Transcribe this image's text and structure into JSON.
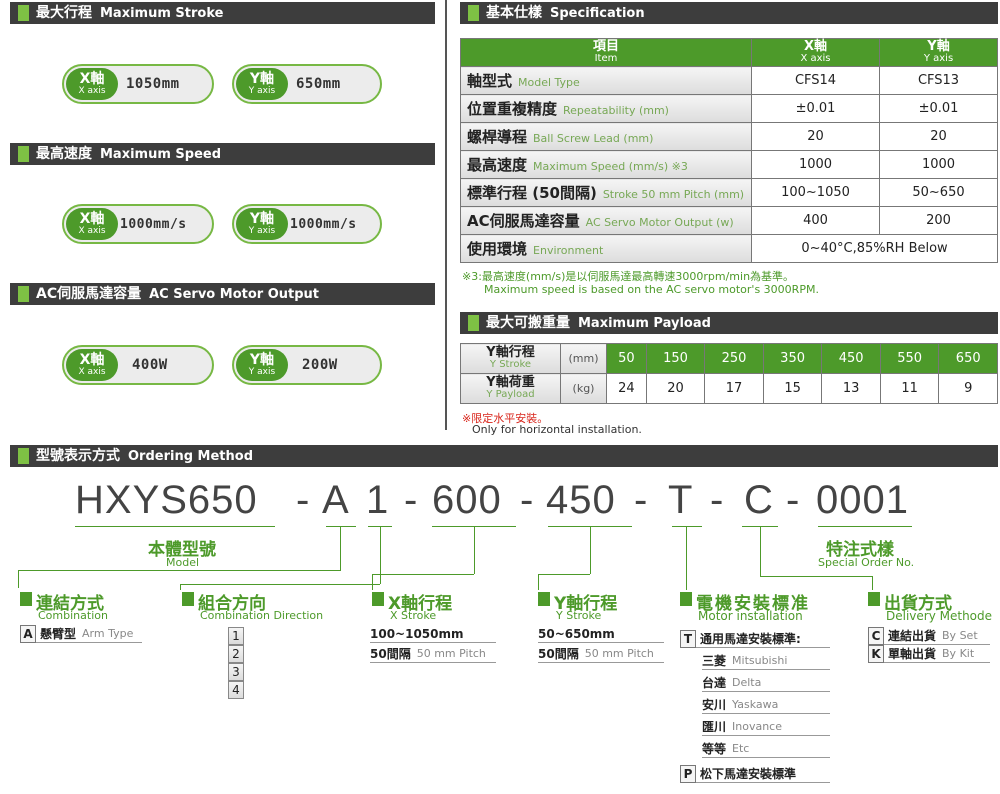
{
  "max_stroke": {
    "title": "最大行程",
    "title_en": "Maximum Stroke",
    "x_label": "X軸",
    "x_en": "X axis",
    "x_value": "1050mm",
    "y_label": "Y軸",
    "y_en": "Y axis",
    "y_value": "650mm"
  },
  "max_speed": {
    "title": "最高速度",
    "title_en": "Maximum Speed",
    "x_label": "X軸",
    "x_en": "X axis",
    "x_value": "1000mm/s",
    "y_label": "Y軸",
    "y_en": "Y axis",
    "y_value": "1000mm/s"
  },
  "servo": {
    "title": "AC伺服馬達容量",
    "title_en": "AC Servo Motor Output",
    "x_label": "X軸",
    "x_en": "X axis",
    "x_value": "400W",
    "y_label": "Y軸",
    "y_en": "Y axis",
    "y_value": "200W"
  },
  "spec": {
    "title": "基本仕樣",
    "title_en": "Specification",
    "head": {
      "item": "項目",
      "item_en": "Item",
      "x": "X軸",
      "x_en": "X axis",
      "y": "Y軸",
      "y_en": "Y axis"
    },
    "rows": [
      {
        "label": "軸型式",
        "en": "Model Type",
        "x": "CFS14",
        "y": "CFS13"
      },
      {
        "label": "位置重複精度",
        "en": "Repeatability (mm)",
        "x": "±0.01",
        "y": "±0.01"
      },
      {
        "label": "螺桿導程",
        "en": "Ball Screw Lead (mm)",
        "x": "20",
        "y": "20"
      },
      {
        "label": "最高速度",
        "en": "Maximum Speed (mm/s) ※3",
        "x": "1000",
        "y": "1000"
      },
      {
        "label": "標準行程 (50間隔)",
        "en": "Stroke 50 mm Pitch (mm)",
        "x": "100~1050",
        "y": "50~650"
      },
      {
        "label": "AC伺服馬達容量",
        "en": "AC Servo Motor Output (w)",
        "x": "400",
        "y": "200"
      }
    ],
    "env": {
      "label": "使用環境",
      "en": "Environment",
      "value": "0~40°C,85%RH Below"
    },
    "note1": "※3:最高速度(mm/s)是以伺服馬達最高轉速3000rpm/min為基準。",
    "note2": "Maximum speed is based on the AC servo motor's 3000RPM."
  },
  "payload": {
    "title": "最大可搬重量",
    "title_en": "Maximum Payload",
    "stroke_label": "Y軸行程",
    "stroke_en": "Y Stroke",
    "stroke_unit": "(mm)",
    "load_label": "Y軸荷重",
    "load_en": "Y Payload",
    "load_unit": "(kg)",
    "strokes": [
      "50",
      "150",
      "250",
      "350",
      "450",
      "550",
      "650"
    ],
    "loads": [
      "24",
      "20",
      "17",
      "15",
      "13",
      "11",
      "9"
    ],
    "note1": "※限定水平安裝。",
    "note2": "Only for horizontal installation."
  },
  "ordering": {
    "title": "型號表示方式",
    "title_en": "Ordering Method",
    "code": [
      "HXYS650",
      "-",
      "A",
      "1",
      "-",
      "600",
      "-",
      "450",
      "-",
      "T",
      "-",
      "C",
      "-",
      "0001"
    ],
    "model_label": "本體型號",
    "model_en": "Model",
    "special_label": "特注式樣",
    "special_en": "Special Order No.",
    "combination": {
      "title": "連結方式",
      "en": "Combination",
      "code": "A",
      "item": "懸臂型",
      "item_en": "Arm Type"
    },
    "direction": {
      "title": "組合方向",
      "en": "Combination Direction",
      "items": [
        "1",
        "2",
        "3",
        "4"
      ]
    },
    "xstroke": {
      "title": "X軸行程",
      "en": "X Stroke",
      "range": "100~1050mm",
      "pitch": "50間隔",
      "pitch_en": "50 mm Pitch"
    },
    "ystroke": {
      "title": "Y軸行程",
      "en": "Y Stroke",
      "range": "50~650mm",
      "pitch": "50間隔",
      "pitch_en": "50 mm Pitch"
    },
    "motor": {
      "title": "電機安裝標准",
      "en": "Motor installation",
      "t_code": "T",
      "t_label": "通用馬達安裝標準:",
      "brands": [
        {
          "zh": "三菱",
          "en": "Mitsubishi"
        },
        {
          "zh": "台達",
          "en": "Delta"
        },
        {
          "zh": "安川",
          "en": "Yaskawa"
        },
        {
          "zh": "匯川",
          "en": "Inovance"
        },
        {
          "zh": "等等",
          "en": "Etc"
        }
      ],
      "p_code": "P",
      "p_label": "松下馬達安裝標準"
    },
    "delivery": {
      "title": "出貨方式",
      "en": "Delivery Methode",
      "items": [
        {
          "code": "C",
          "zh": "連結出貨",
          "en": "By Set"
        },
        {
          "code": "K",
          "zh": "單軸出貨",
          "en": "By Kit"
        }
      ]
    }
  }
}
